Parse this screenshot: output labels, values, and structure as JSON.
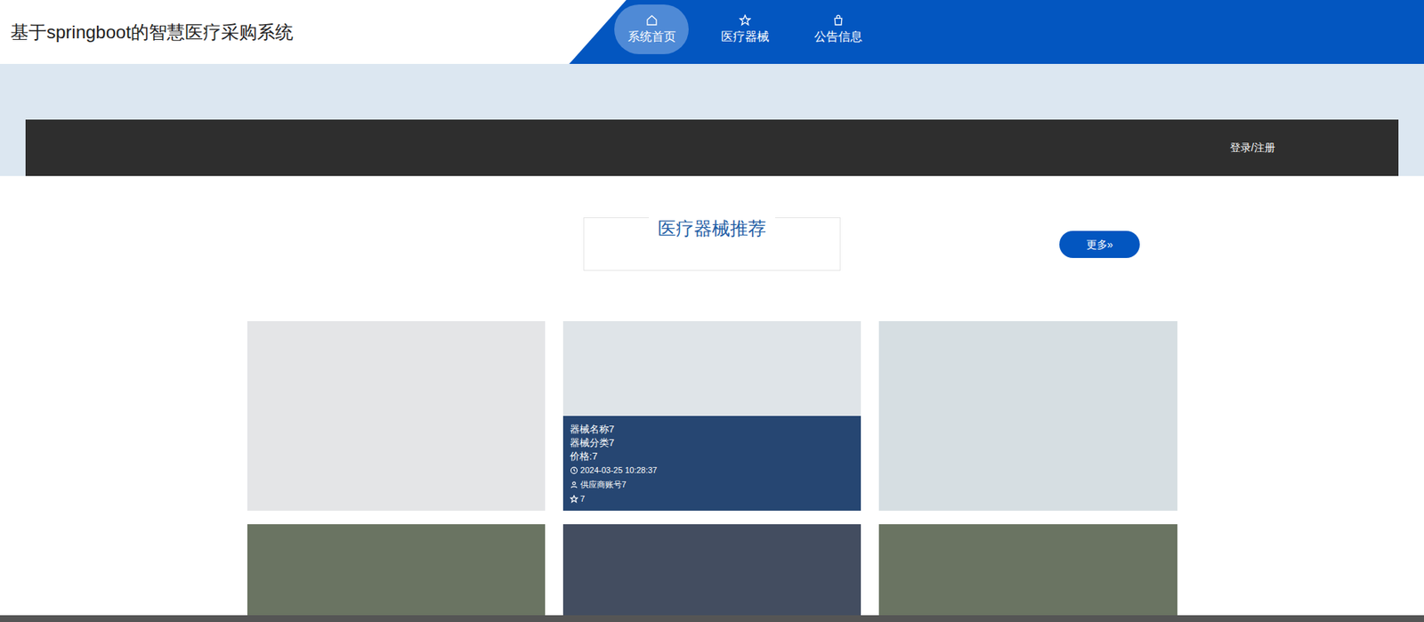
{
  "header": {
    "title": "基于springboot的智慧医疗采购系统"
  },
  "nav": [
    {
      "label": "系统首页",
      "selected": true
    },
    {
      "label": "医疗器械",
      "selected": false
    },
    {
      "label": "公告信息",
      "selected": false
    }
  ],
  "banner": {
    "login": "登录/注册"
  },
  "section": {
    "title": "医疗器械推荐",
    "more": "更多»"
  },
  "products": [
    {
      "hovered": false
    },
    {
      "hovered": true,
      "name": "器械名称7",
      "category": "器械分类7",
      "price": "价格:7",
      "time": "2024-03-25 10:28:37",
      "supplier": "供应商账号7",
      "likes": "7"
    },
    {
      "hovered": false
    },
    {
      "hovered": false
    },
    {
      "hovered": false
    },
    {
      "hovered": false
    }
  ]
}
